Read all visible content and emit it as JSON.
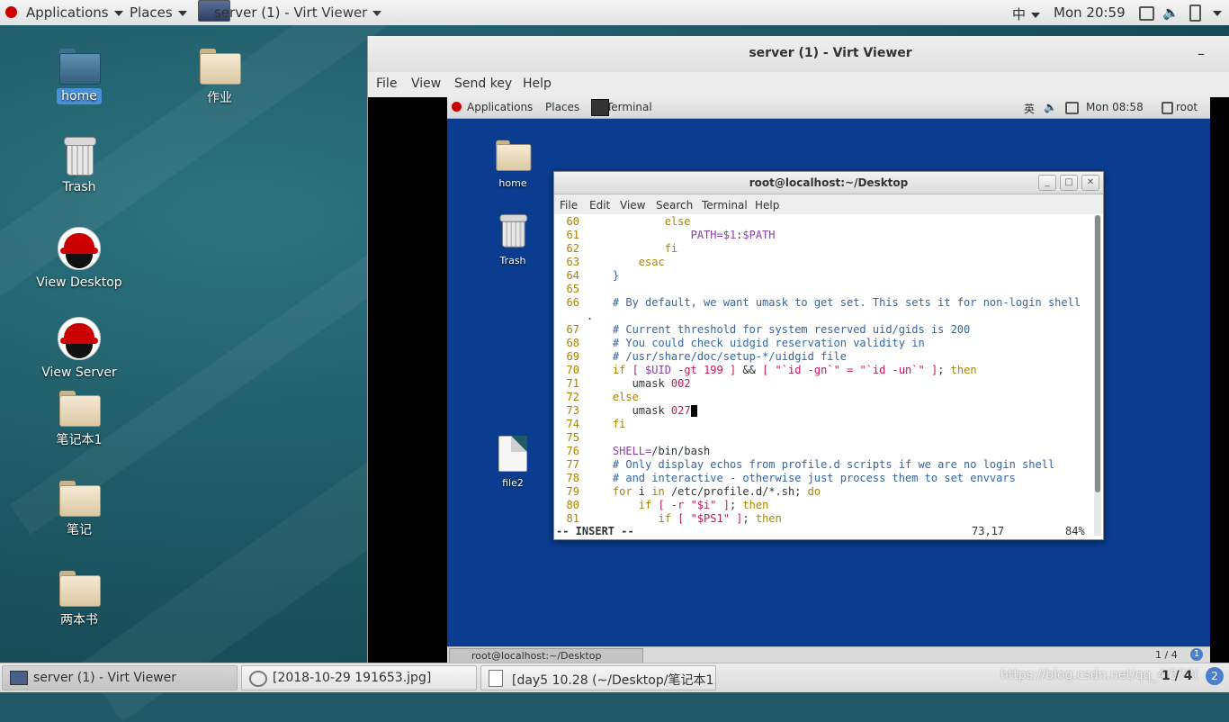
{
  "host": {
    "topbar": {
      "applications": "Applications",
      "places": "Places",
      "window_label": "server (1) - Virt Viewer",
      "input_method": "中",
      "clock": "Mon 20:59"
    },
    "desktop_icons": {
      "home": "home",
      "zuoye": "作业",
      "trash": "Trash",
      "view_desktop": "View Desktop",
      "view_server": "View Server",
      "notebook1": "笔记本1",
      "notes": "笔记",
      "two_books": "两本书"
    },
    "taskbar": {
      "items": [
        "server (1) - Virt Viewer",
        "[2018-10-29 191653.jpg]",
        "[day5 10.28 (~/Desktop/笔记本1..."
      ],
      "watermark": "https://blog.csdn.net/qq_4/373(",
      "workspace": "1 / 4"
    }
  },
  "virt_viewer": {
    "title": "server (1) - Virt Viewer",
    "minimize": "–",
    "menu": [
      "File",
      "View",
      "Send key",
      "Help"
    ]
  },
  "guest": {
    "topbar": {
      "applications": "Applications",
      "places": "Places",
      "terminal_tab": "Terminal",
      "input_method": "英",
      "clock": "Mon 08:58",
      "user": "root"
    },
    "desktop_icons": {
      "home": "home",
      "trash": "Trash",
      "file2": "file2"
    },
    "bottombar": {
      "task": "root@localhost:~/Desktop",
      "workspace": "1 / 4"
    }
  },
  "terminal": {
    "title": "root@localhost:~/Desktop",
    "menu": [
      "File",
      "Edit",
      "View",
      "Search",
      "Terminal",
      "Help"
    ],
    "lines": [
      {
        "n": "60",
        "segments": [
          {
            "c": "kw",
            "t": "            else"
          }
        ]
      },
      {
        "n": "61",
        "segments": [
          {
            "c": "var",
            "t": "                PATH="
          },
          {
            "c": "var",
            "t": "$1"
          },
          {
            "c": "txt",
            "t": ":"
          },
          {
            "c": "var",
            "t": "$PATH"
          }
        ]
      },
      {
        "n": "62",
        "segments": [
          {
            "c": "kw",
            "t": "            fi"
          }
        ]
      },
      {
        "n": "63",
        "segments": [
          {
            "c": "kw",
            "t": "        esac"
          }
        ]
      },
      {
        "n": "64",
        "segments": [
          {
            "c": "cm",
            "t": "    }"
          }
        ]
      },
      {
        "n": "65",
        "segments": []
      },
      {
        "n": "66",
        "segments": [
          {
            "c": "cm",
            "t": "    # By default, we want umask to get set. This sets it for non-login shell"
          }
        ]
      },
      {
        "n": "",
        "segments": [
          {
            "c": "txt",
            "t": "."
          }
        ]
      },
      {
        "n": "67",
        "segments": [
          {
            "c": "cm",
            "t": "    # Current threshold for system reserved uid/gids is 200"
          }
        ]
      },
      {
        "n": "68",
        "segments": [
          {
            "c": "cm",
            "t": "    # You could check uidgid reservation validity in"
          }
        ]
      },
      {
        "n": "69",
        "segments": [
          {
            "c": "cm",
            "t": "    # /usr/share/doc/setup-*/uidgid file"
          }
        ]
      },
      {
        "n": "70",
        "segments": [
          {
            "c": "kw",
            "t": "    if"
          },
          {
            "c": "txt",
            "t": " "
          },
          {
            "c": "str",
            "t": "[ "
          },
          {
            "c": "var",
            "t": "$UID"
          },
          {
            "c": "str",
            "t": " -gt 199 ]"
          },
          {
            "c": "txt",
            "t": " && "
          },
          {
            "c": "str",
            "t": "[ \"`id -gn`\" = \"`id -un`\" ]"
          },
          {
            "c": "txt",
            "t": "; "
          },
          {
            "c": "kw",
            "t": "then"
          }
        ]
      },
      {
        "n": "71",
        "segments": [
          {
            "c": "txt",
            "t": "       umask "
          },
          {
            "c": "str",
            "t": "002"
          }
        ]
      },
      {
        "n": "72",
        "segments": [
          {
            "c": "kw",
            "t": "    else"
          }
        ]
      },
      {
        "n": "73",
        "segments": [
          {
            "c": "txt",
            "t": "       umask "
          },
          {
            "c": "str",
            "t": "027"
          }
        ]
      },
      {
        "n": "74",
        "segments": [
          {
            "c": "kw",
            "t": "    fi"
          }
        ]
      },
      {
        "n": "75",
        "segments": []
      },
      {
        "n": "76",
        "segments": [
          {
            "c": "var",
            "t": "    SHELL="
          },
          {
            "c": "txt",
            "t": "/bin/bash"
          }
        ]
      },
      {
        "n": "77",
        "segments": [
          {
            "c": "cm",
            "t": "    # Only display echos from profile.d scripts if we are no login shell"
          }
        ]
      },
      {
        "n": "78",
        "segments": [
          {
            "c": "cm",
            "t": "    # and interactive - otherwise just process them to set envvars"
          }
        ]
      },
      {
        "n": "79",
        "segments": [
          {
            "c": "kw",
            "t": "    for"
          },
          {
            "c": "txt",
            "t": " i "
          },
          {
            "c": "kw",
            "t": "in"
          },
          {
            "c": "txt",
            "t": " /etc/profile.d/*.sh; "
          },
          {
            "c": "kw",
            "t": "do"
          }
        ]
      },
      {
        "n": "80",
        "segments": [
          {
            "c": "kw",
            "t": "        if"
          },
          {
            "c": "txt",
            "t": " "
          },
          {
            "c": "str",
            "t": "[ -r \"$i\" ]"
          },
          {
            "c": "txt",
            "t": "; "
          },
          {
            "c": "kw",
            "t": "then"
          }
        ]
      },
      {
        "n": "81",
        "segments": [
          {
            "c": "kw",
            "t": "           if"
          },
          {
            "c": "txt",
            "t": " "
          },
          {
            "c": "str",
            "t": "[ \"$PS1\" ]"
          },
          {
            "c": "txt",
            "t": "; "
          },
          {
            "c": "kw",
            "t": "then"
          }
        ]
      }
    ],
    "status": {
      "mode": "-- INSERT --",
      "position": "73,17",
      "percent": "84%"
    }
  }
}
